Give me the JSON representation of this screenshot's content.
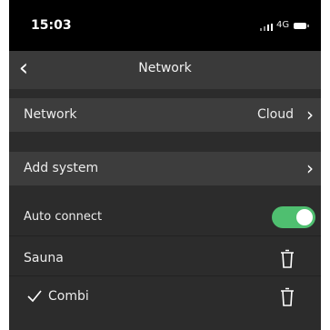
{
  "status_bar": {
    "time": "15:03",
    "network": "4G",
    "signal_icon": "signal-bars-icon",
    "battery_icon": "battery-icon"
  },
  "navbar": {
    "back_icon": "chevron-left-icon",
    "title": "Network"
  },
  "rows": {
    "network": {
      "label": "Network",
      "value": "Cloud"
    },
    "add_system": {
      "label": "Add system"
    },
    "auto_connect": {
      "label": "Auto connect",
      "enabled": true
    },
    "systems": [
      {
        "name": "Sauna",
        "selected": false
      },
      {
        "name": "Combi",
        "selected": true
      }
    ]
  },
  "colors": {
    "background": "#2c2c2c",
    "row": "#3d3d3d",
    "toggle_on": "#4fbf70"
  }
}
